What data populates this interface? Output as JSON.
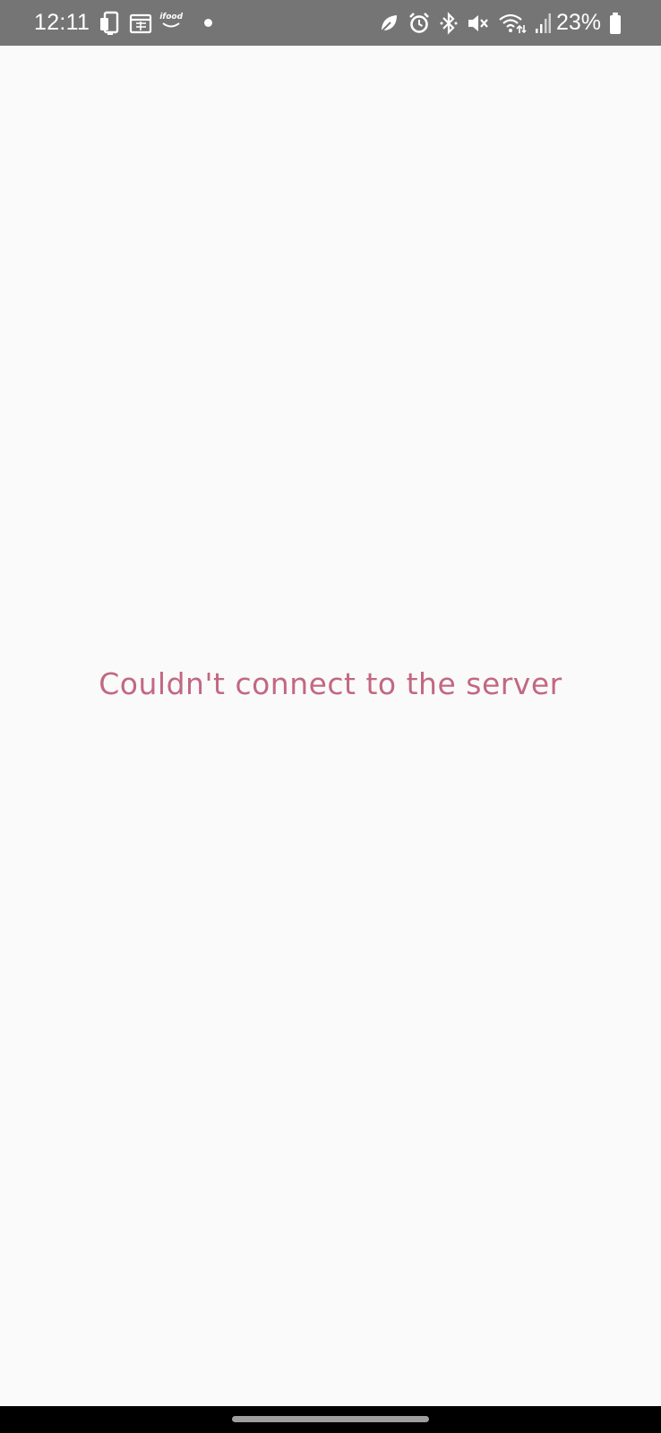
{
  "status_bar": {
    "time": "12:11",
    "notification_icons": [
      "phone-link-icon",
      "calendar-icon",
      "ifood-icon",
      "more-notifications-dot"
    ],
    "ifood_label": "ifood",
    "system_icons": [
      "leaf-icon",
      "alarm-icon",
      "bluetooth-icon",
      "mute-icon",
      "wifi-icon",
      "signal-icon",
      "battery-icon"
    ],
    "battery_percent": "23%",
    "background_color": "#757575"
  },
  "main": {
    "error_message": "Couldn't connect to the server",
    "error_color": "#c26882",
    "background_color": "#fafafa"
  },
  "navigation_bar": {
    "handle": "home-handle",
    "background_color": "#000000"
  }
}
